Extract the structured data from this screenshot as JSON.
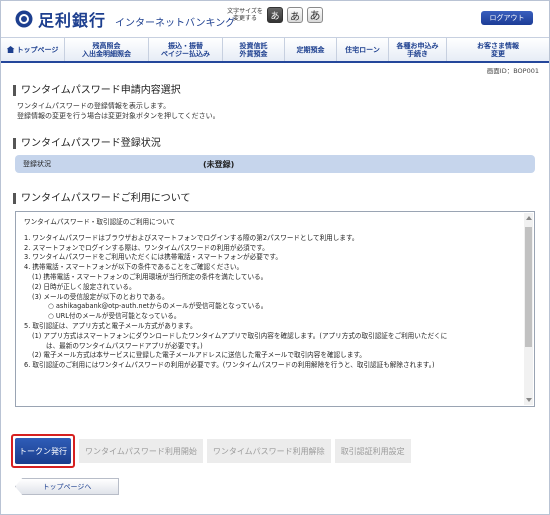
{
  "header": {
    "bank_name": "足利銀行",
    "service_name": "インターネットバンキング",
    "font_size_label_1": "文字サイズを",
    "font_size_label_2": "変更する",
    "font_sizes": [
      "あ",
      "あ",
      "あ"
    ],
    "logout_label": "ログアウト",
    "accent_color": "#1d3f8f"
  },
  "nav": {
    "items": [
      {
        "line1": "トップページ",
        "line2": ""
      },
      {
        "line1": "残高照会",
        "line2": "入出金明細照会"
      },
      {
        "line1": "振込・振替",
        "line2": "ペイジー払込み"
      },
      {
        "line1": "投資信託",
        "line2": "外貨預金"
      },
      {
        "line1": "定期預金",
        "line2": ""
      },
      {
        "line1": "住宅ローン",
        "line2": ""
      },
      {
        "line1": "各種お申込み",
        "line2": "手続き"
      },
      {
        "line1": "お客さま情報",
        "line2": "変更"
      }
    ]
  },
  "screen_id": "画面ID：BOP001",
  "page": {
    "title": "ワンタイムパスワード申請内容選択",
    "desc_1": "ワンタイムパスワードの登録情報を表示します。",
    "desc_2": "登録情報の変更を行う場合は変更対象ボタンを押してください。"
  },
  "status": {
    "heading": "ワンタイムパスワード登録状況",
    "label": "登録状況",
    "value": "(未登録)"
  },
  "usage": {
    "heading": "ワンタイムパスワードご利用について",
    "lines": [
      "ワンタイムパスワード・取引認証のご利用について",
      "",
      "1. ワンタイムパスワードはブラウザおよびスマートフォンでログインする際の第2パスワードとして利用します。",
      "2. スマートフォンでログインする際は、ワンタイムパスワードの利用が必須です。",
      "3. ワンタイムパスワードをご利用いただくには携帯電話・スマートフォンが必要です。",
      "4. 携帯電話・スマートフォンが以下の条件であることをご確認ください。",
      "   (1) 携帯電話・スマートフォンのご利用環境が当行所定の条件を満たしている。",
      "   (2) 日時が正しく設定されている。",
      "   (3) メールの受信設定が以下のとおりである。",
      "         ○ ashikagabank@otp-auth.netからのメールが受信可能となっている。",
      "         ○ URL付のメールが受信可能となっている。",
      "5. 取引認証は、アプリ方式と電子メール方式があります。",
      "   (1) アプリ方式はスマートフォンにダウンロードしたワンタイムアプリで取引内容を確認します。(アプリ方式の取引認証をご利用いただくに",
      "        は、最新のワンタイムパスワードアプリが必要です。)",
      "   (2) 電子メール方式は本サービスに登録した電子メールアドレスに送信した電子メールで取引内容を確認します。",
      "6. 取引認証のご利用にはワンタイムパスワードの利用が必要です。(ワンタイムパスワードの利用解除を行うと、取引認証も解除されます。)"
    ]
  },
  "actions": {
    "token_issue": "トークン発行",
    "otp_start": "ワンタイムパスワード利用開始",
    "otp_cancel": "ワンタイムパスワード利用解除",
    "auth_setting": "取引認証利用設定"
  },
  "back_label": "トップページへ"
}
